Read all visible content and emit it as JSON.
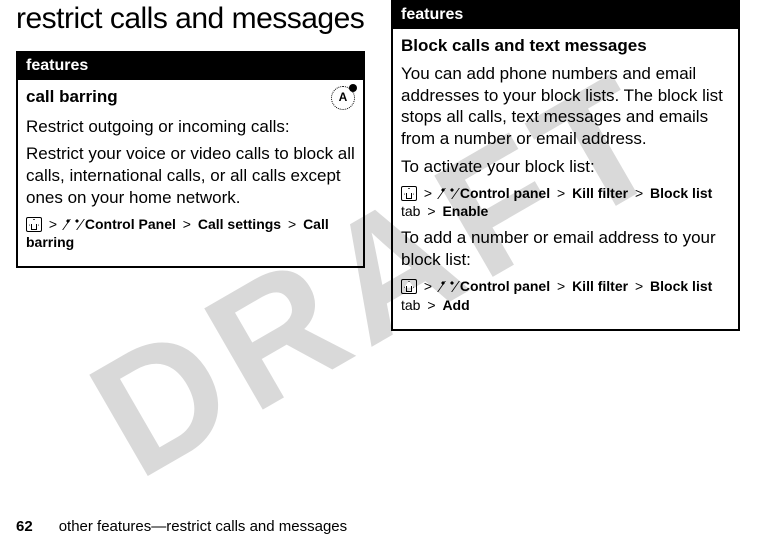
{
  "watermark": "DRAFT",
  "title": "restrict calls and messages",
  "left": {
    "header": "features",
    "feature_title": "call barring",
    "p1": "Restrict outgoing or incoming calls:",
    "p2": "Restrict your voice or video calls to block all calls, international calls, or all calls except ones on your home network.",
    "path": {
      "s1": "Control Panel",
      "s2": "Call settings",
      "s3": "Call barring"
    }
  },
  "right": {
    "header": "features",
    "feature_title": "Block calls and text messages",
    "p1": "You can add phone numbers and email addresses to your block lists. The block list stops all calls, text messages and emails from a number or email address.",
    "p2": "To activate your block list:",
    "path1": {
      "s1": "Control panel",
      "s2": "Kill filter",
      "s3": "Block list",
      "tab": "tab",
      "s4": "Enable"
    },
    "p3": "To add a number or email address to your block list:",
    "path2": {
      "s1": "Control panel",
      "s2": "Kill filter",
      "s3": "Block list",
      "tab": "tab",
      "s4": "Add"
    }
  },
  "footer": {
    "page": "62",
    "text": "other features—restrict calls and messages"
  },
  "gt": ">"
}
